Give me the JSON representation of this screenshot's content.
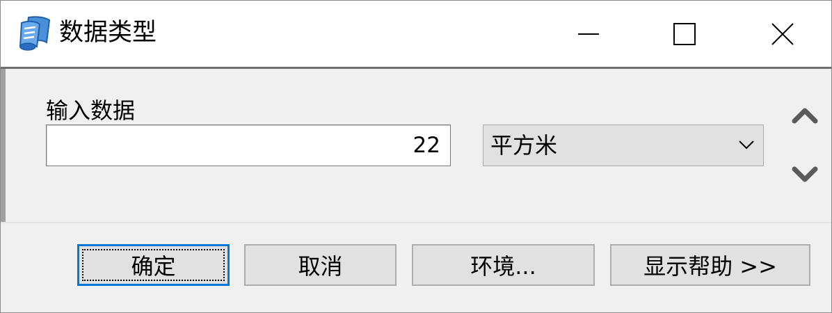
{
  "window": {
    "title": "数据类型",
    "controls": {
      "minimize": "minimize-icon",
      "maximize": "maximize-icon",
      "close": "close-icon"
    }
  },
  "form": {
    "input_label": "输入数据",
    "input_value": "22",
    "unit_selected": "平方米"
  },
  "buttons": {
    "ok": "确定",
    "cancel": "取消",
    "environment": "环境...",
    "show_help": "显示帮助 >>"
  },
  "colors": {
    "focus_border": "#0078d7",
    "button_bg": "#e1e1e1",
    "dialog_bg": "#f0f0f0"
  }
}
